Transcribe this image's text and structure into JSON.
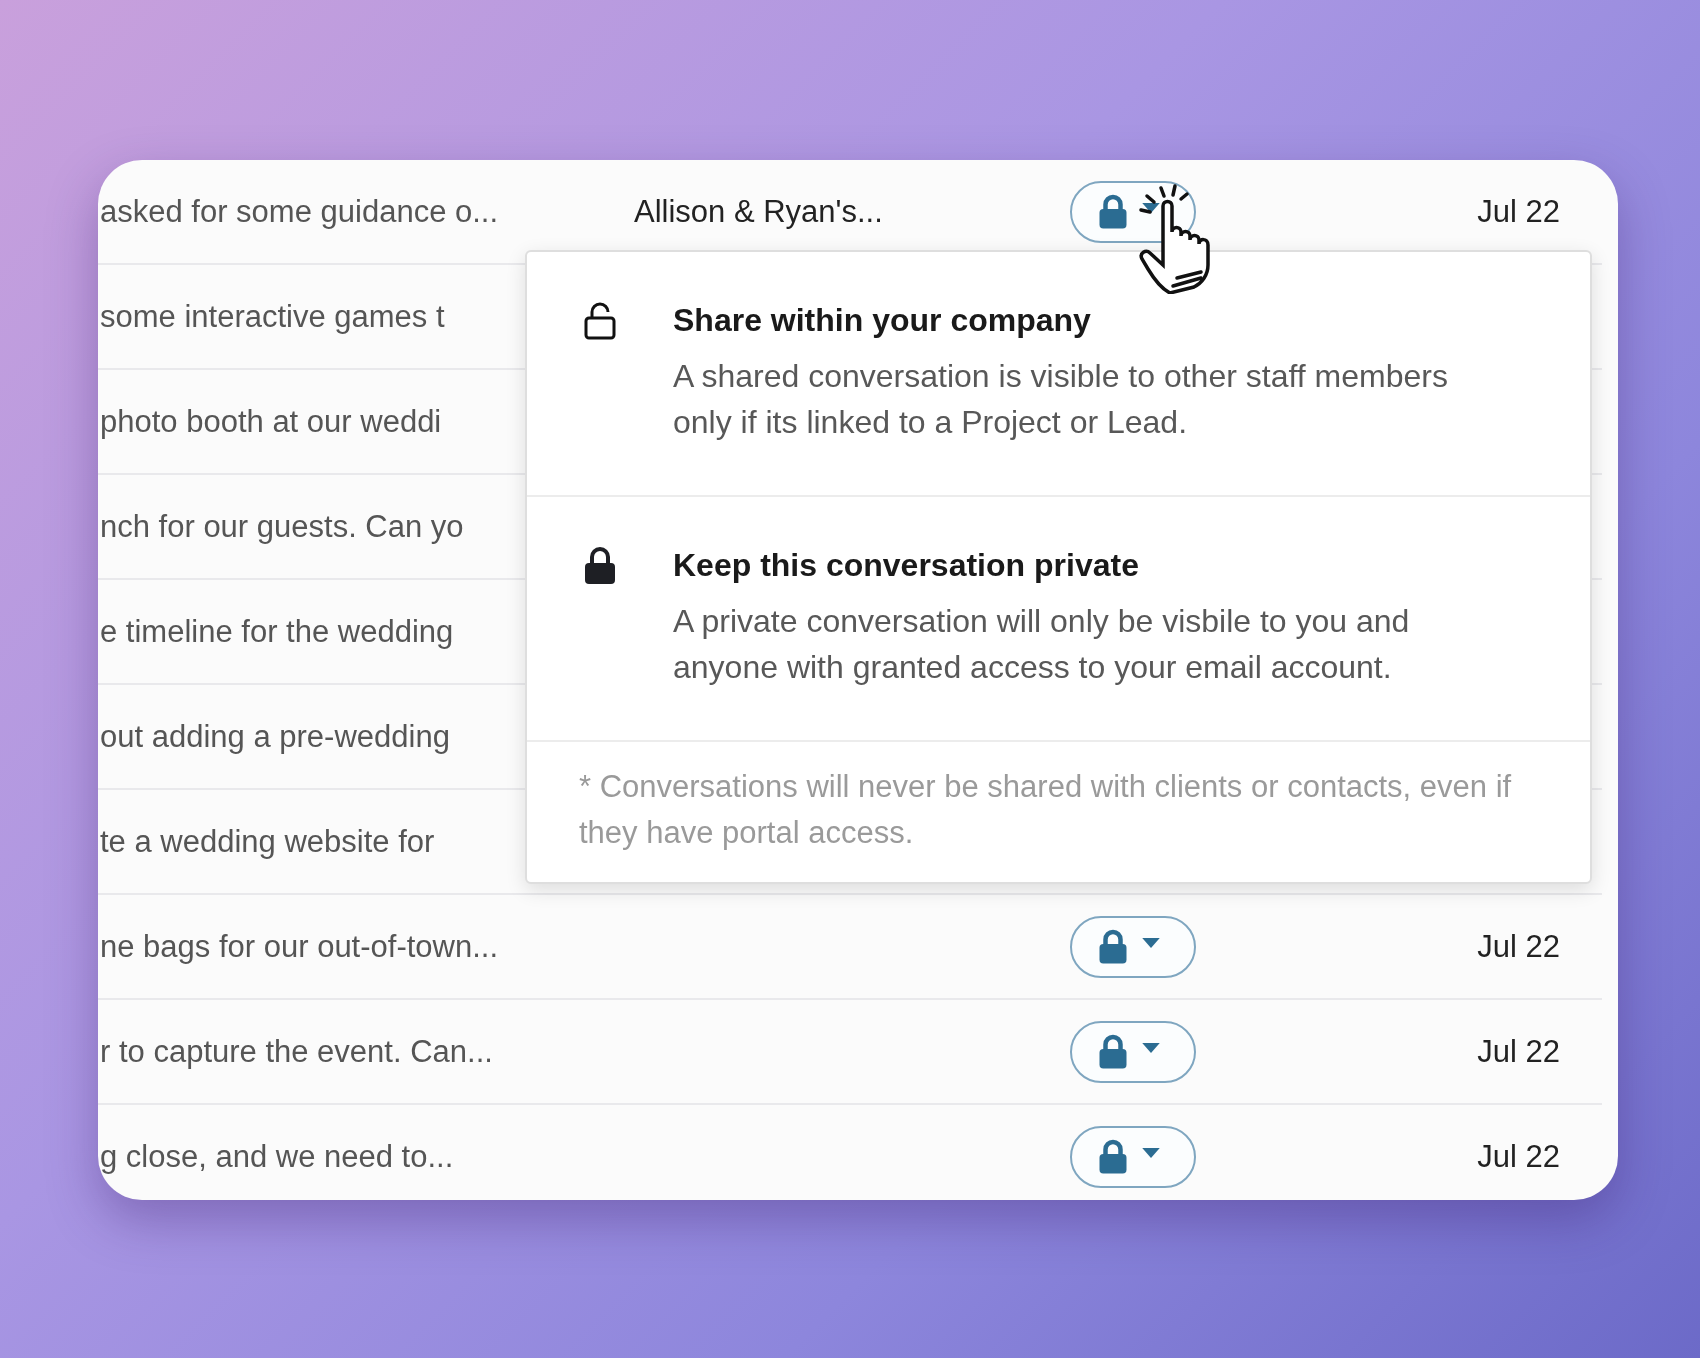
{
  "rows": [
    {
      "snippet": "asked for some guidance o...",
      "project": "Allison & Ryan's...",
      "private": true,
      "date": "Jul 22"
    },
    {
      "snippet": "some interactive games t"
    },
    {
      "snippet": "photo booth at our weddi"
    },
    {
      "snippet": "nch for our guests. Can yo"
    },
    {
      "snippet": "e timeline for the wedding"
    },
    {
      "snippet": "out adding a pre-wedding"
    },
    {
      "snippet": "te a wedding website for"
    },
    {
      "snippet": "ne bags for our out-of-town...",
      "private": true,
      "date": "Jul 22"
    },
    {
      "snippet": "r to capture the event. Can...",
      "private": true,
      "date": "Jul 22"
    },
    {
      "snippet": "g close, and we need to...",
      "private": true,
      "date": "Jul 22"
    }
  ],
  "privacy_menu": {
    "options": [
      {
        "kind": "shared",
        "title": "Share within your company",
        "description": "A shared conversation is visible to other staff members only if its linked to a Project or Lead."
      },
      {
        "kind": "private",
        "title": "Keep this conversation private",
        "description": "A private conversation will only be visbile to you and anyone with granted access to your email account."
      }
    ],
    "footnote": "* Conversations will never be shared with clients or contacts, even if they have portal access."
  }
}
